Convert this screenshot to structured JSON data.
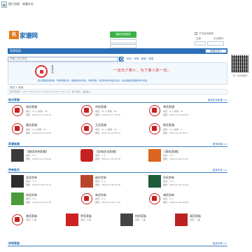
{
  "top": {
    "tiny_links": "图片加载 · 收藏本站",
    "login_label": "微信扫码登录"
  },
  "header": {
    "logo_mark": "姓",
    "logo_text": "家谱网",
    "auto_login": "下次自动登录",
    "register": "注册",
    "forgot": "忘记密码"
  },
  "nav": {
    "title": "家谱导航",
    "right_button": "家谱分类 ▾"
  },
  "search": {
    "placeholder": "请输入姓氏查询",
    "links": "姓氏 · 宗祠 · 家谱 · 寻根"
  },
  "qr": {
    "caption": "扫一扫关注我们"
  },
  "banner": {
    "side_text": "姓氏文化",
    "slogan": "一切为了族人，为了族人的一切。",
    "desc": "建立家族谱资料库，传承家族文化，联络海内外宗亲，寻根问祖，共同弘扬中华姓氏文化，欢迎各地宗亲踊跃参与共建。"
  },
  "breadcrumb": "首页 > 家谱",
  "filter": "按字母查找：A B C D E F G H J K L M N O P Q R S T W X Y Z · 热门姓氏 · 最新加入",
  "sections": [
    {
      "title": "姓氏家谱",
      "more": "更多姓氏家谱 >>"
    },
    {
      "title": "家谱族谱",
      "more": "更多家谱 >>"
    },
    {
      "title": "宗亲姓氏",
      "more": "更多宗亲 >>"
    },
    {
      "title": "宗祠家族",
      "more": "更多宗祠 >>"
    }
  ],
  "cards": [
    {
      "name": "刘氏家谱",
      "l1": "成员：15 人  收录：26",
      "l2": "更新：2016-11-13 14:30"
    },
    {
      "name": "李氏家谱",
      "l1": "成员：8 人  收录：11",
      "l2": "更新：2016-11-12 09:45"
    },
    {
      "name": "王氏家谱",
      "l1": "成员：21 人  收录：40",
      "l2": "更新：2016-11-12 08:12"
    },
    {
      "name": "陈氏家谱",
      "l1": "成员：6 人  收录：9",
      "l2": "更新：2016-11-11 20:07"
    },
    {
      "name": "张氏家谱",
      "l1": "成员：12 人  收录：18",
      "l2": "更新：2016-11-11 16:33"
    },
    {
      "name": "黄氏家谱",
      "l1": "成员：9 人  收录：14",
      "l2": "更新：2016-11-10 11:50"
    },
    {
      "name": "【周氏宗亲家谱】",
      "l1": "成员：5 人",
      "l2": "更新：2016-11-10 10:02"
    },
    {
      "name": "【学海文化家谱】",
      "l1": "成员：7 人",
      "l2": "更新：2016-11-09 18:26"
    },
    {
      "name": "【郭氏家谱】",
      "l1": "成员：4 人",
      "l2": "更新：2016-11-09 15:41"
    },
    {
      "name": "吴氏宗亲",
      "l1": "成员：3 人",
      "l2": "更新：2016-11-08 13:17"
    },
    {
      "name": "赵氏宗亲",
      "l1": "成员：6 人",
      "l2": "更新：2016-11-08 12:05"
    },
    {
      "name": "孙氏宗亲",
      "l1": "成员：2 人",
      "l2": "更新：2016-11-07 19:44"
    },
    {
      "name": "徐氏宗亲",
      "l1": "成员：5 人",
      "l2": "更新：2016-11-07 09:30"
    },
    {
      "name": "朱氏宗亲",
      "l1": "成员：8 人",
      "l2": "更新：2016-11-06 17:22"
    },
    {
      "name": "胡氏宗亲",
      "l1": "成员：4 人",
      "l2": "更新：2016-11-06 08:58"
    },
    {
      "name": "林氏家族",
      "l1": "宗祠：1 座",
      "l2": ""
    },
    {
      "name": "罗氏家族",
      "l1": "宗祠：2 座",
      "l2": ""
    },
    {
      "name": "何氏家族",
      "l1": "宗祠：1 座",
      "l2": ""
    },
    {
      "name": "高氏家族",
      "l1": "宗祠：3 座",
      "l2": ""
    }
  ],
  "colors": {
    "brand_blue": "#2a6fb8",
    "seal_red": "#c82020",
    "accent_orange": "#e47b1d",
    "wechat_green": "#3cb34a"
  }
}
